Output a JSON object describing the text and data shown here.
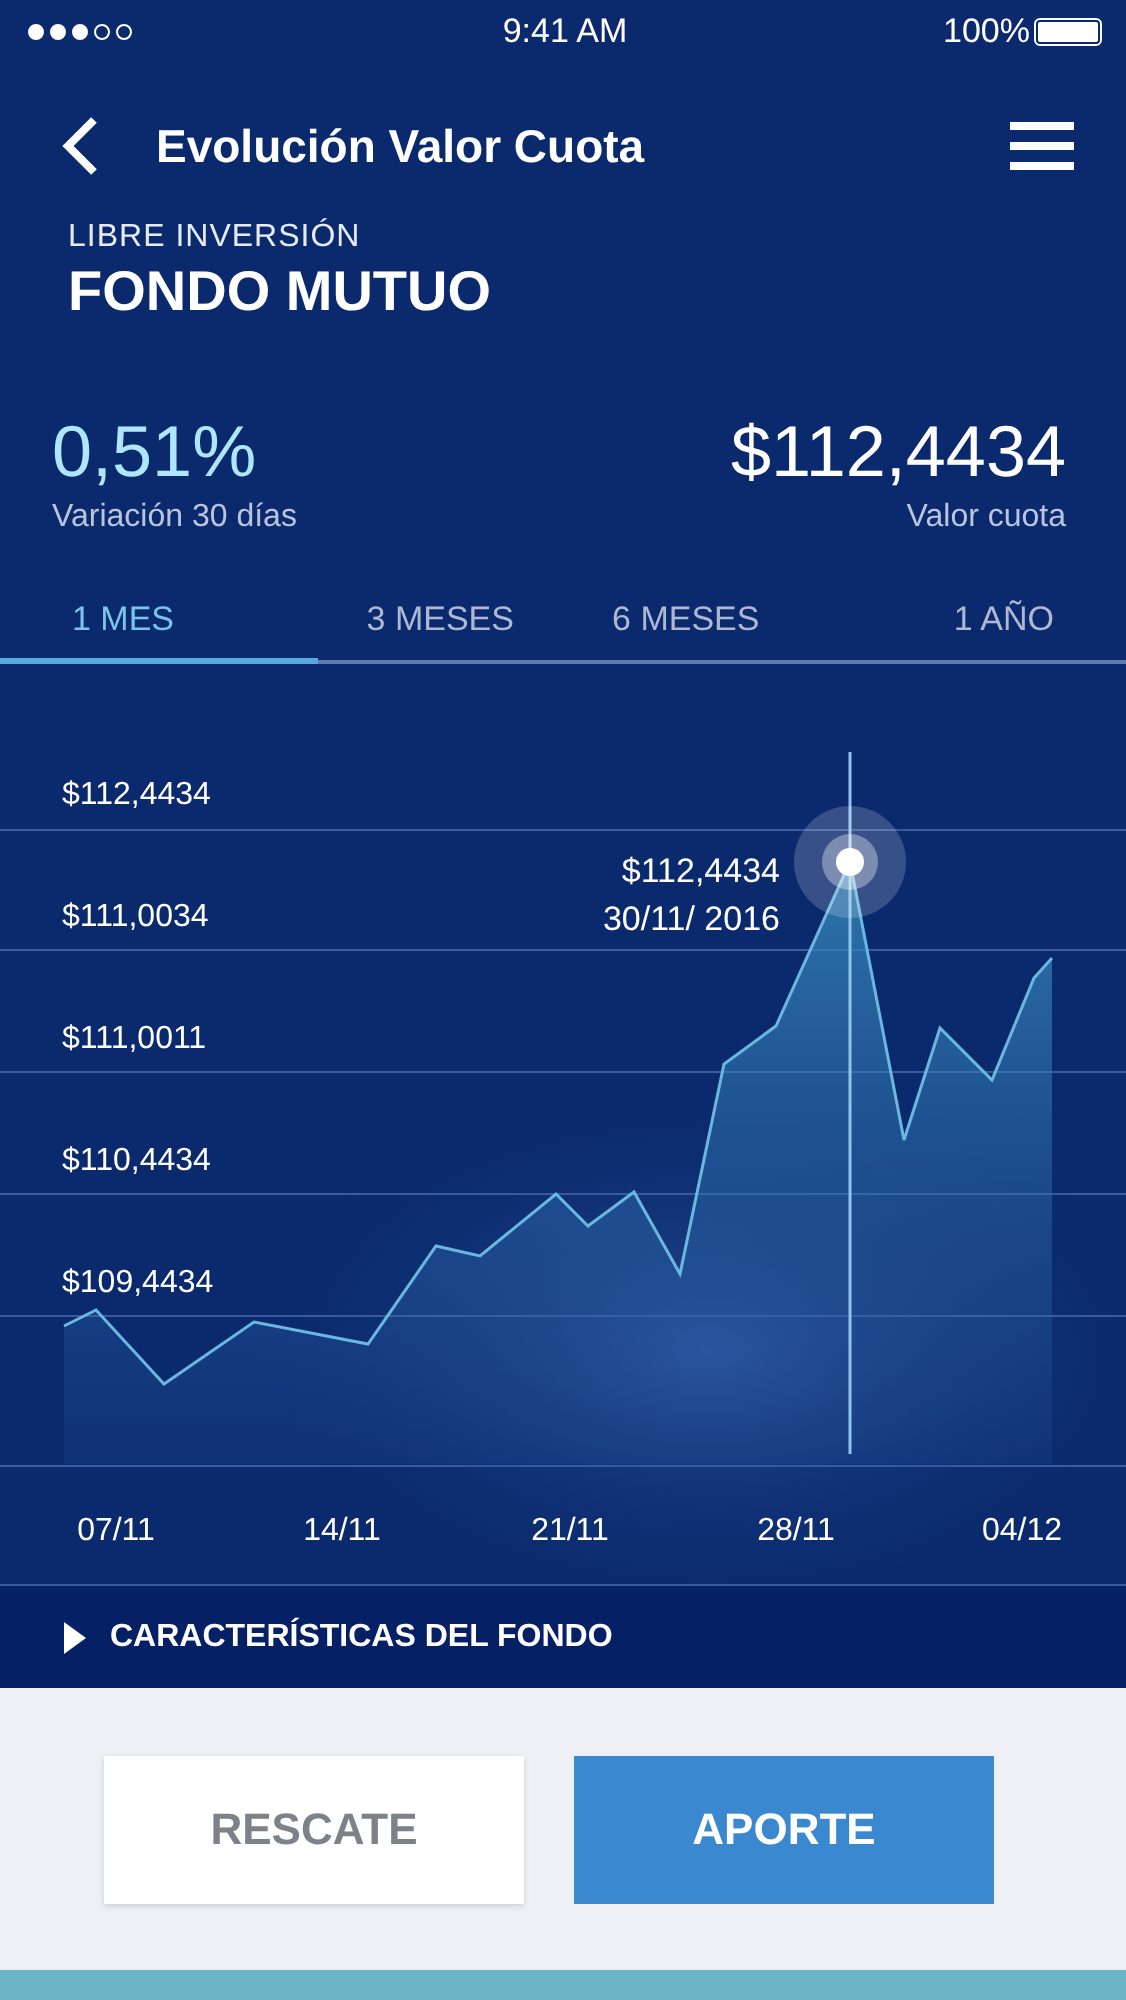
{
  "status_bar": {
    "signal_dots": [
      {
        "filled": true
      },
      {
        "filled": true
      },
      {
        "filled": true
      },
      {
        "filled": false
      },
      {
        "filled": false
      }
    ],
    "time": "9:41 AM",
    "battery": "100%"
  },
  "header": {
    "title": "Evolución Valor Cuota"
  },
  "fund": {
    "category": "LIBRE INVERSIÓN",
    "name": "FONDO MUTUO"
  },
  "stats": [
    {
      "value": "0,51%",
      "label": "Variación 30 días",
      "kind": "variation"
    },
    {
      "value": "$112,4434",
      "label": "Valor cuota",
      "kind": "price"
    }
  ],
  "tabs": [
    {
      "label": "1 MES",
      "selected": true
    },
    {
      "label": "3 MESES",
      "selected": false
    },
    {
      "label": "6 MESES",
      "selected": false
    },
    {
      "label": "1 AÑO",
      "selected": false
    }
  ],
  "chart": {
    "y_labels": [
      "$112,4434",
      "$111,0034",
      "$111,0011",
      "$110,4434",
      "$109,4434"
    ],
    "x_labels": [
      "07/11",
      "14/11",
      "21/11",
      "28/11",
      "04/12"
    ],
    "tooltip": {
      "value": "$112,4434",
      "date": "30/11/ 2016"
    }
  },
  "section": {
    "label": "CARACTERÍSTICAS DEL FONDO",
    "expanded": false
  },
  "buttons": [
    {
      "label": "RESCATE",
      "kind": "secondary"
    },
    {
      "label": "APORTE",
      "kind": "primary"
    }
  ]
}
